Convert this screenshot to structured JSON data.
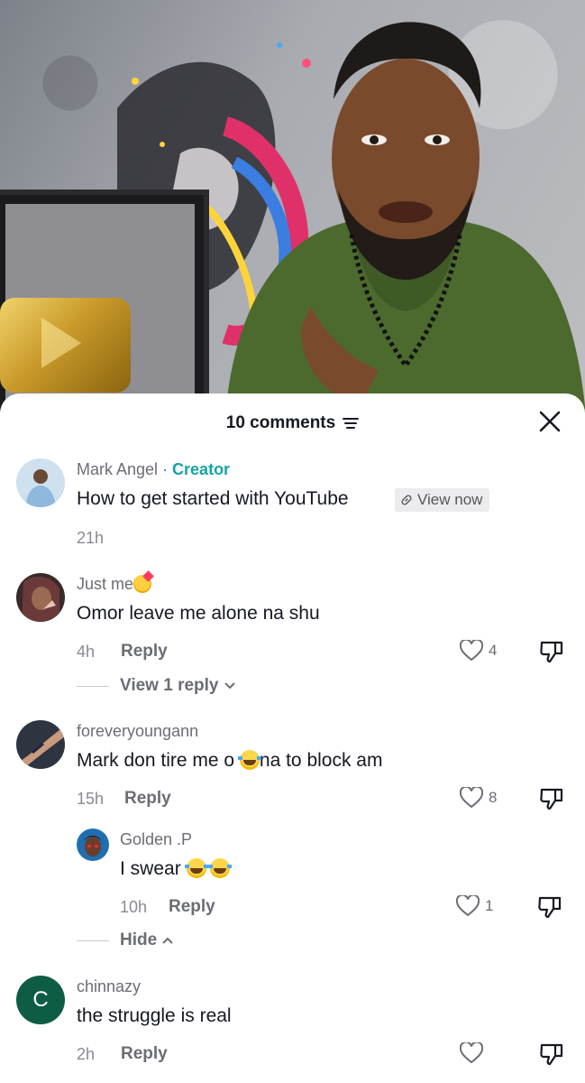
{
  "colors": {
    "accent_creator": "#17a3a3",
    "text_primary": "#161823",
    "text_secondary": "#6b6d73",
    "avatar_c_bg": "#0f5c44"
  },
  "sheet": {
    "title": "10 comments",
    "sort_icon": "sort-lines-icon",
    "close_icon": "close-icon"
  },
  "comments": [
    {
      "username": "Mark Angel",
      "separator": " · ",
      "badge": "Creator",
      "text": "How to get started with YouTube",
      "link_chip": "View now",
      "time": "21h"
    },
    {
      "username": "Just me",
      "text": "Omor leave me alone na shu",
      "time": "4h",
      "reply_label": "Reply",
      "likes": "4",
      "view_replies": "View 1 reply"
    },
    {
      "username": "foreveryoungann",
      "text_before": "Mark don tire me o ",
      "text_after": "na to block am",
      "time": "15h",
      "reply_label": "Reply",
      "likes": "8",
      "replies": [
        {
          "username": "Golden .P",
          "text": "I swear ",
          "time": "10h",
          "reply_label": "Reply",
          "likes": "1"
        }
      ],
      "hide_label": "Hide"
    },
    {
      "username": "chinnazy",
      "avatar_letter": "C",
      "text": "the struggle is real",
      "time": "2h",
      "reply_label": "Reply",
      "likes": ""
    }
  ]
}
